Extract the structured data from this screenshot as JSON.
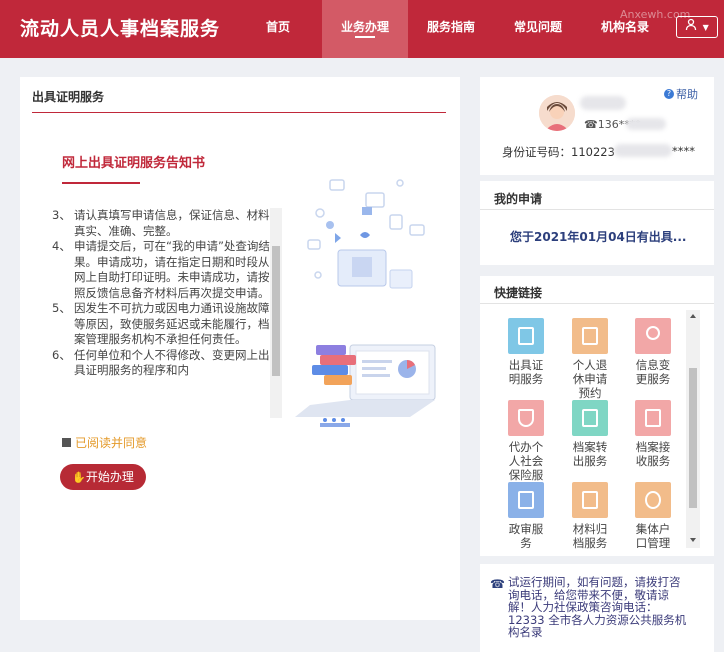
{
  "header": {
    "brand": "流动人员人事档案服务",
    "nav": [
      "首页",
      "业务办理",
      "服务指南",
      "常见问题",
      "机构名录"
    ],
    "active_index": 1,
    "watermark": "Anxewh.com",
    "user_menu_icon": "user-icon"
  },
  "left_panel": {
    "title": "出具证明服务",
    "notice_title": "网上出具证明服务告知书",
    "items": [
      {
        "num": "3、",
        "text": "请认真填写申请信息，保证信息、材料真实、准确、完整。"
      },
      {
        "num": "4、",
        "text": "申请提交后，可在“我的申请”处查询结果。申请成功，请在指定日期和时段从网上自助打印证明。未申请成功，请按照反馈信息备齐材料后再次提交申请。"
      },
      {
        "num": "5、",
        "text": "因发生不可抗力或因电力通讯设施故障等原因，致使服务延迟或未能履行，档案管理服务机构不承担任何责任。"
      },
      {
        "num": "6、",
        "text": "任何单位和个人不得修改、变更网上出具证明服务的程序和内"
      }
    ],
    "agree_label": "已阅读并同意",
    "start_button": "开始办理"
  },
  "profile": {
    "help": "帮助",
    "phone": "☎136****",
    "id_label": "身份证号码：110223",
    "id_tail": "****"
  },
  "my_applications": {
    "title": "我的申请",
    "item": "您于2021年01月04日有出具..."
  },
  "quick_links": {
    "title": "快捷链接",
    "items": [
      {
        "label": "出具证明服务",
        "color": "#7fc7e6"
      },
      {
        "label": "个人退休申请预约",
        "color": "#f2bc8a"
      },
      {
        "label": "信息变更服务",
        "color": "#f2a7a7"
      },
      {
        "label": "代办个人社会保险服",
        "color": "#f2a7a7"
      },
      {
        "label": "档案转出服务",
        "color": "#7fd6c4"
      },
      {
        "label": "档案接收服务",
        "color": "#f2a7a7"
      },
      {
        "label": "政审服务",
        "color": "#8ab1e8"
      },
      {
        "label": "材料归档服务",
        "color": "#f2bc8a"
      },
      {
        "label": "集体户口管理",
        "color": "#f2bc8a"
      }
    ]
  },
  "info": {
    "text": "试运行期间，如有问题，请拨打咨询电话，给您带来不便，敬请谅解！人力社保政策咨询电话：12333 全市各人力资源公共服务机构名录"
  },
  "colors": {
    "brand": "#c0283a",
    "nav_active": "#d35a66",
    "link": "#2c3f7c"
  }
}
